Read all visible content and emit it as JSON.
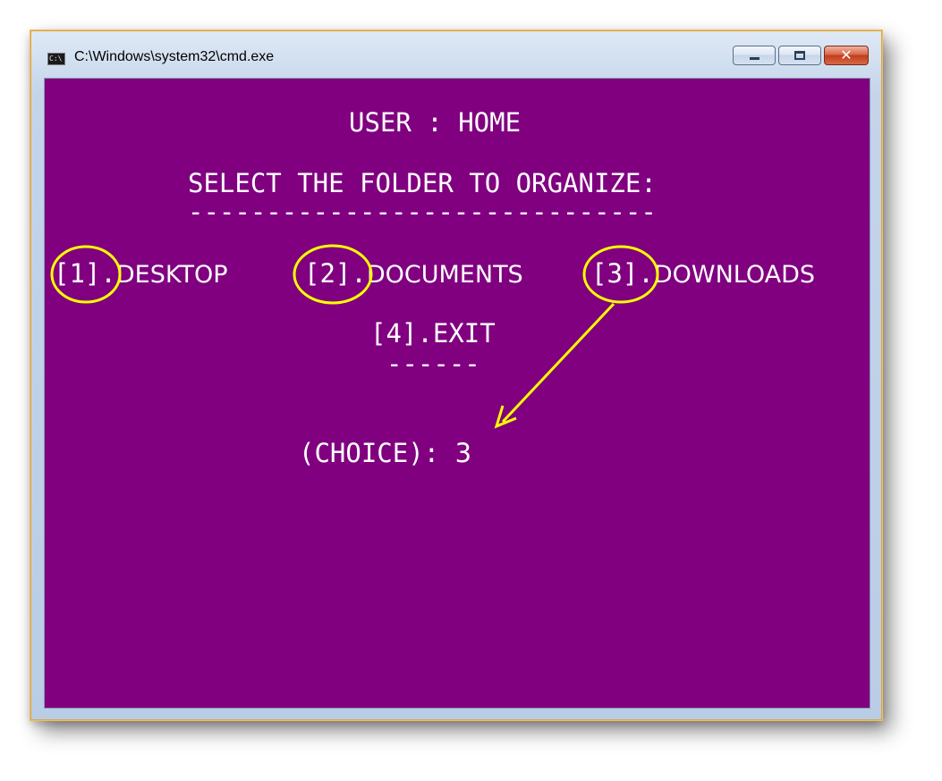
{
  "window": {
    "title": "C:\\Windows\\system32\\cmd.exe",
    "icon": "console-icon",
    "icon_text": "C:\\",
    "controls": {
      "minimize": "minimize-icon",
      "maximize": "maximize-icon",
      "close": "close-icon",
      "close_glyph": "✕"
    }
  },
  "console": {
    "background": "#800080",
    "foreground": "#ffffff",
    "header": "USER : HOME",
    "prompt_heading": "SELECT THE FOLDER TO ORGANIZE:",
    "prompt_underline": "------------------------------",
    "options": [
      {
        "key": "[1]",
        "sep": ".",
        "label": "DESKTOP"
      },
      {
        "key": "[2]",
        "sep": ".",
        "label": "DOCUMENTS"
      },
      {
        "key": "[3]",
        "sep": ".",
        "label": "DOWNLOADS"
      }
    ],
    "exit_option": {
      "key": "[4]",
      "sep": ".",
      "label": "EXIT"
    },
    "exit_underline": "------",
    "choice_prompt": "(CHOICE): ",
    "choice_value": "3"
  },
  "annotations": {
    "color": "#ffff00",
    "circled_options": [
      "[1]",
      "[2]",
      "[3]"
    ],
    "arrow": {
      "from": "[3]",
      "to": "choice_value"
    }
  }
}
